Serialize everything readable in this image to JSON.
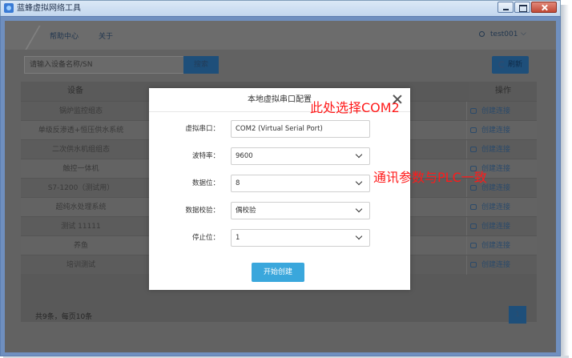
{
  "window": {
    "title": "蓝蜂虚拟网络工具"
  },
  "nav": {
    "help": "帮助中心",
    "about": "关于",
    "user": "test001",
    "user_chevron": "⌵"
  },
  "toolbar": {
    "search_placeholder": "请输入设备名称/SN",
    "search_label": "搜索",
    "refresh_label": "刷新"
  },
  "table": {
    "headers": {
      "device": "设备",
      "operation": "操作"
    },
    "rows": [
      {
        "device": "锅炉监控组态",
        "operation": "创建连接"
      },
      {
        "device": "单级反渗透+恒压供水系统",
        "operation": "创建连接"
      },
      {
        "device": "二次供水机组组态",
        "operation": "创建连接"
      },
      {
        "device": "触控一体机",
        "operation": "创建连接"
      },
      {
        "device": "S7-1200（测试用）",
        "operation": "创建连接"
      },
      {
        "device": "超纯水处理系统",
        "operation": "创建连接"
      },
      {
        "device": "测试 11111",
        "operation": "创建连接"
      },
      {
        "device": "养鱼",
        "operation": "创建连接"
      },
      {
        "device": "培训测试",
        "operation": "创建连接"
      }
    ]
  },
  "pagination": {
    "info": "共9条，每页10条",
    "current_page": "1"
  },
  "modal": {
    "title": "本地虚拟串口配置",
    "fields": [
      {
        "label": "虚拟串口：",
        "value": "COM2 (Virtual Serial Port)"
      },
      {
        "label": "波特率：",
        "value": "9600"
      },
      {
        "label": "数据位：",
        "value": "8"
      },
      {
        "label": "数据校验：",
        "value": "偶校验"
      },
      {
        "label": "停止位：",
        "value": "1"
      }
    ],
    "start_label": "开始创建"
  },
  "annotations": {
    "com2": "此处选择COM2",
    "params": "通讯参数与PLC一致",
    "color": "#ff1a1a"
  },
  "colors": {
    "primary_button": "#3aa7dc",
    "overlay": "#626262"
  }
}
